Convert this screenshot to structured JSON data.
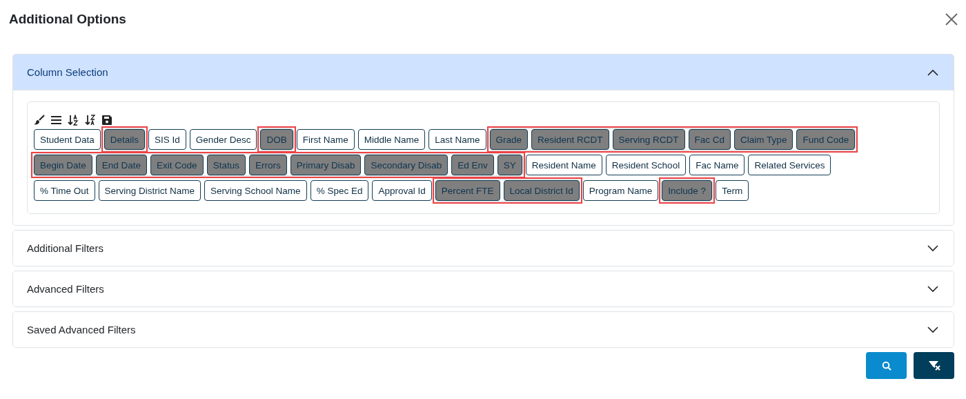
{
  "dialog": {
    "title": "Additional Options"
  },
  "sections": [
    {
      "title": "Column Selection",
      "expanded": true,
      "rows": [
        {
          "groups": [
            {
              "highlighted": false,
              "chips": [
                {
                  "label": "Student Data",
                  "selected": false
                }
              ]
            },
            {
              "highlighted": true,
              "chips": [
                {
                  "label": "Details",
                  "selected": true
                }
              ]
            },
            {
              "highlighted": false,
              "chips": [
                {
                  "label": "SIS Id",
                  "selected": false
                },
                {
                  "label": "Gender Desc",
                  "selected": false
                }
              ]
            },
            {
              "highlighted": true,
              "chips": [
                {
                  "label": "DOB",
                  "selected": true
                }
              ]
            },
            {
              "highlighted": false,
              "chips": [
                {
                  "label": "First Name",
                  "selected": false
                },
                {
                  "label": "Middle Name",
                  "selected": false
                },
                {
                  "label": "Last Name",
                  "selected": false
                }
              ]
            },
            {
              "highlighted": true,
              "chips": [
                {
                  "label": "Grade",
                  "selected": true
                },
                {
                  "label": "Resident RCDT",
                  "selected": true
                },
                {
                  "label": "Serving RCDT",
                  "selected": true
                },
                {
                  "label": "Fac Cd",
                  "selected": true
                },
                {
                  "label": "Claim Type",
                  "selected": true
                },
                {
                  "label": "Fund Code",
                  "selected": true
                }
              ]
            }
          ]
        },
        {
          "groups": [
            {
              "highlighted": true,
              "chips": [
                {
                  "label": "Begin Date",
                  "selected": true
                },
                {
                  "label": "End Date",
                  "selected": true
                },
                {
                  "label": "Exit Code",
                  "selected": true
                },
                {
                  "label": "Status",
                  "selected": true
                },
                {
                  "label": "Errors",
                  "selected": true
                },
                {
                  "label": "Primary Disab",
                  "selected": true
                },
                {
                  "label": "Secondary Disab",
                  "selected": true
                },
                {
                  "label": "Ed Env",
                  "selected": true
                },
                {
                  "label": "SY",
                  "selected": true
                }
              ]
            },
            {
              "highlighted": false,
              "chips": [
                {
                  "label": "Resident Name",
                  "selected": false
                },
                {
                  "label": "Resident School",
                  "selected": false
                },
                {
                  "label": "Fac Name",
                  "selected": false
                },
                {
                  "label": "Related Services",
                  "selected": false
                }
              ]
            }
          ]
        },
        {
          "groups": [
            {
              "highlighted": false,
              "chips": [
                {
                  "label": "% Time Out",
                  "selected": false
                },
                {
                  "label": "Serving District Name",
                  "selected": false
                },
                {
                  "label": "Serving School Name",
                  "selected": false
                },
                {
                  "label": "% Spec Ed",
                  "selected": false
                },
                {
                  "label": "Approval Id",
                  "selected": false
                }
              ]
            },
            {
              "highlighted": true,
              "chips": [
                {
                  "label": "Percent FTE",
                  "selected": true
                },
                {
                  "label": "Local District Id",
                  "selected": true
                }
              ]
            },
            {
              "highlighted": false,
              "chips": [
                {
                  "label": "Program Name",
                  "selected": false
                }
              ]
            },
            {
              "highlighted": true,
              "chips": [
                {
                  "label": "Include ?",
                  "selected": true
                }
              ]
            },
            {
              "highlighted": false,
              "chips": [
                {
                  "label": "Term",
                  "selected": false
                }
              ]
            }
          ]
        }
      ]
    },
    {
      "title": "Additional Filters",
      "expanded": false
    },
    {
      "title": "Advanced Filters",
      "expanded": false
    },
    {
      "title": "Saved Advanced Filters",
      "expanded": false
    }
  ]
}
